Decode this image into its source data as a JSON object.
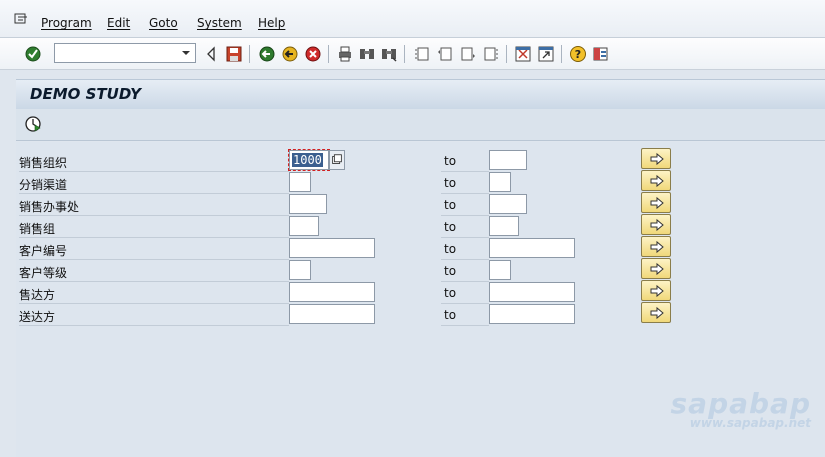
{
  "menu": {
    "items": [
      {
        "label": "Program"
      },
      {
        "label": "Edit"
      },
      {
        "label": "Goto"
      },
      {
        "label": "System"
      },
      {
        "label": "Help"
      }
    ]
  },
  "toolbar": {
    "command_field_value": "",
    "icons": [
      "enter-icon",
      "back-arrow-icon",
      "save-icon",
      "back-icon",
      "exit-icon",
      "cancel-icon",
      "print-icon",
      "find-icon",
      "find-next-icon",
      "first-page-icon",
      "prev-page-icon",
      "next-page-icon",
      "last-page-icon",
      "create-session-icon",
      "shortcut-icon",
      "help-icon",
      "layout-icon"
    ]
  },
  "title": "DEMO STUDY",
  "app_toolbar": {
    "icons": [
      "execute-icon"
    ]
  },
  "form": {
    "to_label": "to",
    "rows": [
      {
        "label": "销售组织",
        "low": "1000",
        "high": ""
      },
      {
        "label": "分销渠道",
        "low": "",
        "high": ""
      },
      {
        "label": "销售办事处",
        "low": "",
        "high": ""
      },
      {
        "label": "销售组",
        "low": "",
        "high": ""
      },
      {
        "label": "客户编号",
        "low": "",
        "high": ""
      },
      {
        "label": "客户等级",
        "low": "",
        "high": ""
      },
      {
        "label": "售达方",
        "low": "",
        "high": ""
      },
      {
        "label": "送达方",
        "low": "",
        "high": ""
      }
    ]
  },
  "watermark": {
    "brand": "sapabap",
    "url": "www.sapabap.net"
  }
}
